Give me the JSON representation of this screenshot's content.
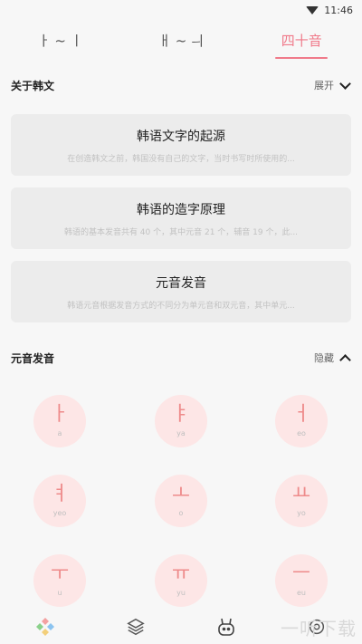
{
  "status_bar": {
    "time": "11:46",
    "wifi_icon": "wifi-icon"
  },
  "tabs": [
    {
      "label": "ㅏ ~ ㅣ",
      "active": false
    },
    {
      "label": "ㅐ ~ ㅢ",
      "active": false
    },
    {
      "label": "四十音",
      "active": true
    }
  ],
  "about": {
    "title": "关于韩文",
    "toggle_label": "展开",
    "cards": [
      {
        "title": "韩语文字的起源",
        "desc": "在创造韩文之前，韩国没有自己的文字，当时书写时所使用的..."
      },
      {
        "title": "韩语的造字原理",
        "desc": "韩语的基本发音共有 40 个，其中元音 21 个，辅音 19 个，此..."
      },
      {
        "title": "元音发音",
        "desc": "韩语元音根据发音方式的不同分为单元音和双元音，其中单元..."
      }
    ]
  },
  "vowels_section": {
    "title": "元音发音",
    "toggle_label": "隐藏",
    "vowels": [
      {
        "char": "ㅏ",
        "roman": "a"
      },
      {
        "char": "ㅑ",
        "roman": "ya"
      },
      {
        "char": "ㅓ",
        "roman": "eo"
      },
      {
        "char": "ㅕ",
        "roman": "yeo"
      },
      {
        "char": "ㅗ",
        "roman": "o"
      },
      {
        "char": "ㅛ",
        "roman": "yo"
      },
      {
        "char": "ㅜ",
        "roman": "u"
      },
      {
        "char": "ㅠ",
        "roman": "yu"
      },
      {
        "char": "ㅡ",
        "roman": "eu"
      }
    ]
  },
  "bottom_nav": [
    {
      "icon": "grid-icon"
    },
    {
      "icon": "layers-icon"
    },
    {
      "icon": "bunny-icon"
    },
    {
      "icon": "settings-icon"
    }
  ],
  "watermark": "一听下载",
  "colors": {
    "accent": "#f07a8a",
    "vowel_bg": "#fde6e6",
    "vowel_char": "#ee8b8b",
    "card_bg": "#ececec"
  }
}
